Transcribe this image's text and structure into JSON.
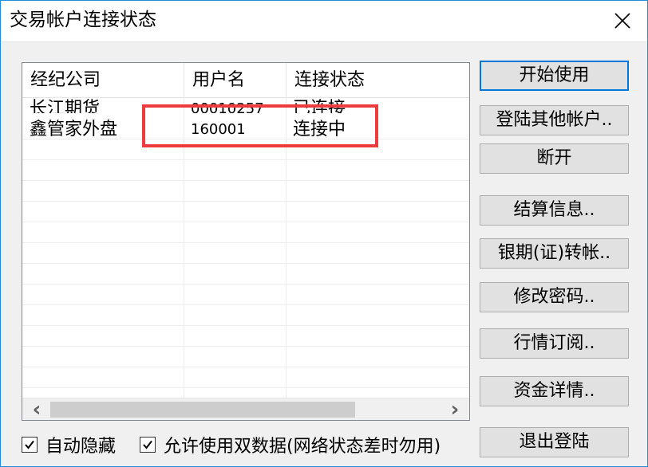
{
  "window": {
    "title": "交易帐户连接状态",
    "close_glyph": "✕"
  },
  "list": {
    "columns": [
      "经纪公司",
      "用户名",
      "连接状态"
    ],
    "rows": [
      {
        "broker": "长江期货",
        "username": "00010257",
        "status": "已连接"
      },
      {
        "broker": "鑫管家外盘",
        "username": "160001",
        "status": "连接中"
      }
    ]
  },
  "scrollbar": {
    "left_arrow": "‹",
    "right_arrow": "›"
  },
  "buttons": {
    "start": "开始使用",
    "login_other": "登陆其他帐户..",
    "disconnect": "断开",
    "settlement": "结算信息..",
    "bank_transfer": "银期(证)转帐..",
    "change_password": "修改密码..",
    "quote_subscribe": "行情订阅..",
    "fund_detail": "资金详情..",
    "logout": "退出登陆"
  },
  "checkboxes": {
    "auto_hide": {
      "label": "自动隐藏",
      "checked": true
    },
    "dual_data": {
      "label": "允许使用双数据(网络状态差时勿用)",
      "checked": true
    }
  },
  "colors": {
    "highlight": "#ef3b3b",
    "accent": "#0078d7"
  }
}
